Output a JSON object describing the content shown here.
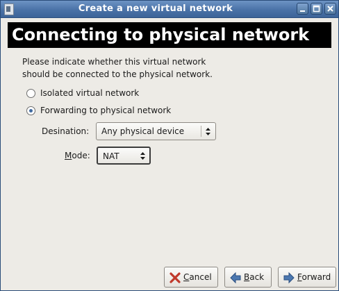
{
  "window": {
    "title": "Create a new virtual network"
  },
  "banner": {
    "title": "Connecting to physical network"
  },
  "intro": {
    "line1": "Please indicate whether this virtual network",
    "line2": "should be connected to the physical network."
  },
  "options": {
    "isolated": {
      "label": "Isolated virtual network",
      "selected": false
    },
    "forwarding": {
      "label": "Forwarding to physical network",
      "selected": true
    }
  },
  "destination": {
    "label": "Desination:",
    "value": "Any physical device"
  },
  "mode": {
    "label_mnemonic": "M",
    "label_rest": "ode:",
    "value": "NAT"
  },
  "buttons": {
    "cancel": {
      "mnemonic": "C",
      "rest": "ancel"
    },
    "back": {
      "mnemonic": "B",
      "rest": "ack"
    },
    "forward": {
      "mnemonic": "F",
      "rest": "orward"
    }
  },
  "colors": {
    "titlebar": "#4a72a7",
    "banner_bg": "#000000",
    "dialog_bg": "#edebe6",
    "radio_dot": "#3f6aa0"
  }
}
